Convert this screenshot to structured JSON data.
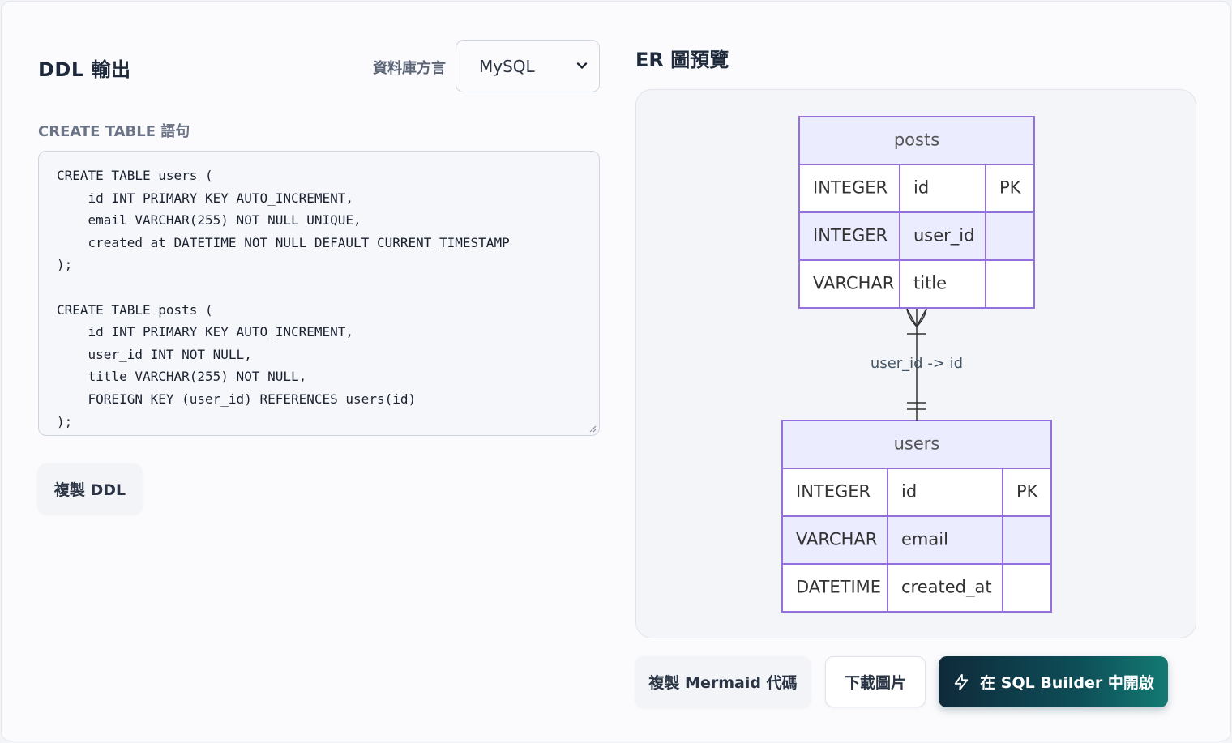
{
  "ddl": {
    "title": "DDL 輸出",
    "dialect_label": "資料庫方言",
    "dialect_value": "MySQL",
    "statement_label": "CREATE TABLE 語句",
    "code": "CREATE TABLE users (\n    id INT PRIMARY KEY AUTO_INCREMENT,\n    email VARCHAR(255) NOT NULL UNIQUE,\n    created_at DATETIME NOT NULL DEFAULT CURRENT_TIMESTAMP\n);\n\nCREATE TABLE posts (\n    id INT PRIMARY KEY AUTO_INCREMENT,\n    user_id INT NOT NULL,\n    title VARCHAR(255) NOT NULL,\n    FOREIGN KEY (user_id) REFERENCES users(id)\n);",
    "copy_button": "複製 DDL"
  },
  "er": {
    "title": "ER 圖預覽",
    "tables": [
      {
        "name": "posts",
        "rows": [
          {
            "type": "INTEGER",
            "column": "id",
            "key": "PK"
          },
          {
            "type": "INTEGER",
            "column": "user_id",
            "key": ""
          },
          {
            "type": "VARCHAR",
            "column": "title",
            "key": ""
          }
        ]
      },
      {
        "name": "users",
        "rows": [
          {
            "type": "INTEGER",
            "column": "id",
            "key": "PK"
          },
          {
            "type": "VARCHAR",
            "column": "email",
            "key": ""
          },
          {
            "type": "DATETIME",
            "column": "created_at",
            "key": ""
          }
        ]
      }
    ],
    "relation_label": "user_id -> id",
    "colors": {
      "border": "#9370db",
      "header_fill": "#ececff",
      "row_fill_odd": "#ffffff",
      "row_fill_even": "#ececff",
      "text": "#333333",
      "header_text": "#555555"
    }
  },
  "actions": {
    "copy_mermaid": "複製 Mermaid 代碼",
    "download_image": "下載圖片",
    "open_builder": "在 SQL Builder 中開啟"
  }
}
